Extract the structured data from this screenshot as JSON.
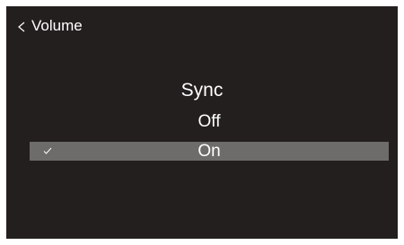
{
  "header": {
    "back_icon": "chevron-left-icon",
    "title": "Volume"
  },
  "page": {
    "title": "Sync"
  },
  "options": [
    {
      "label": "Off",
      "selected": false
    },
    {
      "label": "On",
      "selected": true,
      "check_icon": "checkmark-icon"
    }
  ],
  "colors": {
    "background": "#231f1e",
    "selection": "#6d6c6b",
    "text": "#ffffff"
  }
}
